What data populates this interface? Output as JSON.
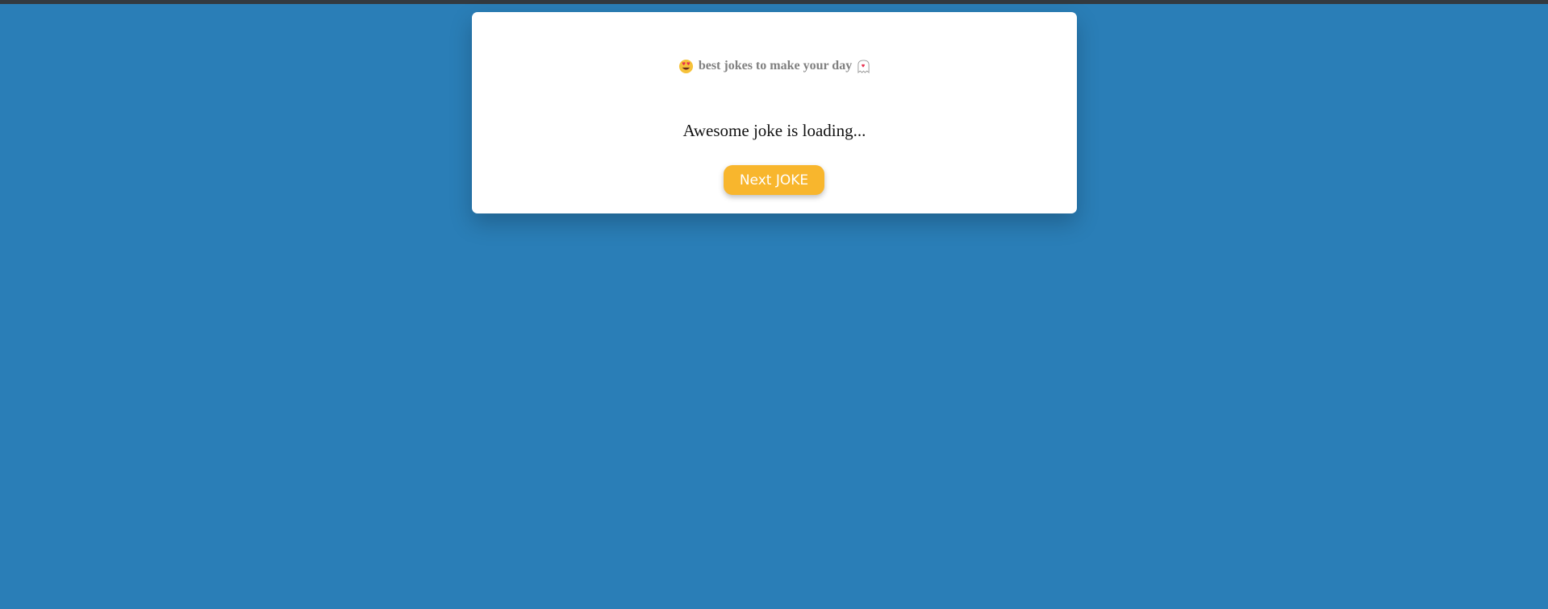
{
  "header": {
    "title": "best jokes to make your day",
    "left_icon": "smiling-face-with-heart-eyes-icon",
    "right_icon": "ghost-with-heart-icon"
  },
  "joke": {
    "text": "Awesome joke is loading..."
  },
  "button": {
    "label": "Next JOKE"
  },
  "colors": {
    "background": "#2a7eb7",
    "top_bar": "#333a40",
    "card": "#ffffff",
    "button": "#f8b62d",
    "button_text": "#ffffff",
    "header_text": "#808080",
    "joke_text": "#111111"
  }
}
